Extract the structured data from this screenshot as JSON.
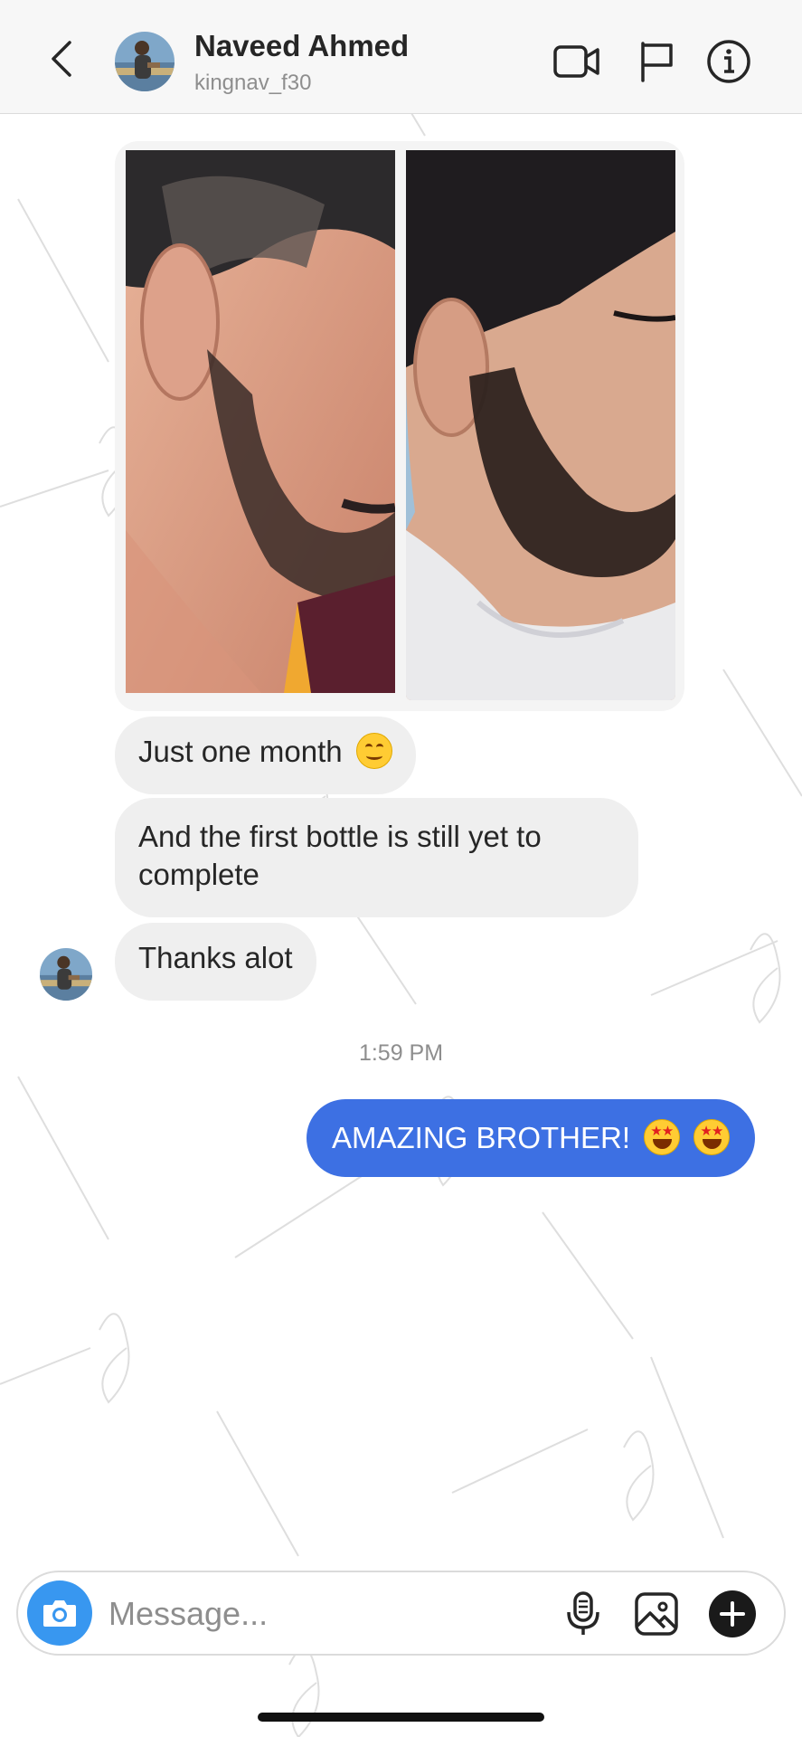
{
  "header": {
    "back_icon": "chevron-left-icon",
    "contact_name": "Naveed Ahmed",
    "contact_username": "kingnav_f30",
    "actions": [
      "video-call-icon",
      "flag-icon",
      "info-icon"
    ]
  },
  "conversation": {
    "attachment": {
      "type": "photo-pair",
      "image_count": 2
    },
    "incoming_messages": [
      {
        "text": "Just one month",
        "emoji": "smiling-face-emoji"
      },
      {
        "text": "And the first bottle is still yet to complete"
      },
      {
        "text": "Thanks alot"
      }
    ],
    "timestamp": "1:59 PM",
    "outgoing_messages": [
      {
        "text": "AMAZING BROTHER!",
        "emoji": [
          "star-struck-emoji",
          "star-struck-emoji"
        ]
      }
    ]
  },
  "composer": {
    "placeholder": "Message...",
    "icons": [
      "camera-icon",
      "microphone-icon",
      "gallery-icon",
      "plus-icon"
    ]
  },
  "colors": {
    "header_bg": "#f7f7f7",
    "incoming_bubble": "#efefef",
    "outgoing_bubble": "#3d70e3",
    "camera_button": "#3897f0",
    "secondary_text": "#8e8e8e"
  }
}
